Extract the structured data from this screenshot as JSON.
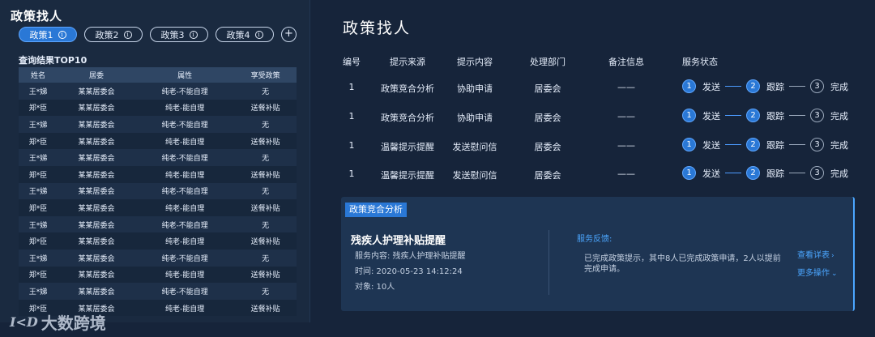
{
  "left": {
    "title": "政策找人",
    "tabs": [
      {
        "label": "政策1",
        "active": true
      },
      {
        "label": "政策2",
        "active": false
      },
      {
        "label": "政策3",
        "active": false
      },
      {
        "label": "政策4",
        "active": false
      }
    ],
    "add_label": "+",
    "result_title": "查询结果TOP10",
    "columns": [
      "姓名",
      "居委",
      "属性",
      "享受政策"
    ],
    "rows": [
      [
        "王*娣",
        "某某居委会",
        "纯老-不能自理",
        "无"
      ],
      [
        "郑*臣",
        "某某居委会",
        "纯老-能自理",
        "送餐补贴"
      ],
      [
        "王*娣",
        "某某居委会",
        "纯老-不能自理",
        "无"
      ],
      [
        "郑*臣",
        "某某居委会",
        "纯老-能自理",
        "送餐补贴"
      ],
      [
        "王*娣",
        "某某居委会",
        "纯老-不能自理",
        "无"
      ],
      [
        "郑*臣",
        "某某居委会",
        "纯老-能自理",
        "送餐补贴"
      ],
      [
        "王*娣",
        "某某居委会",
        "纯老-不能自理",
        "无"
      ],
      [
        "郑*臣",
        "某某居委会",
        "纯老-能自理",
        "送餐补贴"
      ],
      [
        "王*娣",
        "某某居委会",
        "纯老-不能自理",
        "无"
      ],
      [
        "郑*臣",
        "某某居委会",
        "纯老-能自理",
        "送餐补贴"
      ],
      [
        "王*娣",
        "某某居委会",
        "纯老-不能自理",
        "无"
      ],
      [
        "郑*臣",
        "某某居委会",
        "纯老-能自理",
        "送餐补贴"
      ],
      [
        "王*娣",
        "某某居委会",
        "纯老-不能自理",
        "无"
      ],
      [
        "郑*臣",
        "某某居委会",
        "纯老-能自理",
        "送餐补贴"
      ]
    ]
  },
  "watermark": {
    "logo": "I<D",
    "text": "大数跨境"
  },
  "right": {
    "title": "政策找人",
    "columns": {
      "no": "编号",
      "source": "提示来源",
      "content": "提示内容",
      "dept": "处理部门",
      "note": "备注信息",
      "status": "服务状态"
    },
    "rows": [
      {
        "no": "1",
        "source": "政策竞合分析",
        "content": "协助申请",
        "dept": "居委会",
        "note": "——"
      },
      {
        "no": "1",
        "source": "政策竞合分析",
        "content": "协助申请",
        "dept": "居委会",
        "note": "——"
      },
      {
        "no": "1",
        "source": "温馨提示提醒",
        "content": "发送慰问信",
        "dept": "居委会",
        "note": "——"
      },
      {
        "no": "1",
        "source": "温馨提示提醒",
        "content": "发送慰问信",
        "dept": "居委会",
        "note": "——"
      }
    ],
    "steps": [
      {
        "num": "1",
        "label": "发送",
        "state": "done"
      },
      {
        "num": "2",
        "label": "跟踪",
        "state": "done"
      },
      {
        "num": "3",
        "label": "完成",
        "state": "todo"
      }
    ],
    "card": {
      "badge": "政策竞合分析",
      "title": "残疾人护理补贴提醒",
      "service_content": "服务内容:  残疾人护理补贴提醒",
      "time": "时间:  2020-05-23   14:12:24",
      "target": "对象:  10人",
      "feedback_label": "服务反馈:",
      "feedback_text": "已完成政策提示，其中8人已完成政策申请，2人以提前完成申请。",
      "view_details": "查看详表",
      "more_actions": "更多操作"
    }
  },
  "colors": {
    "accent": "#2a78d6",
    "background": "#16243a",
    "link": "#4ba6ff"
  }
}
